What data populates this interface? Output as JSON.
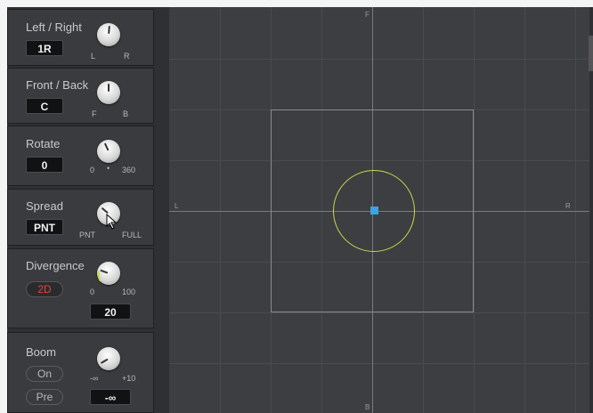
{
  "controls": {
    "left_right": {
      "title": "Left / Right",
      "value": "1R",
      "min": "L",
      "max": "R"
    },
    "front_back": {
      "title": "Front / Back",
      "value": "C",
      "min": "F",
      "max": "B"
    },
    "rotate": {
      "title": "Rotate",
      "value": "0",
      "min": "0",
      "mid": "•",
      "max": "360"
    },
    "spread": {
      "title": "Spread",
      "value": "PNT",
      "min": "PNT",
      "max": "FULL"
    },
    "divergence": {
      "title": "Divergence",
      "mode": "2D",
      "min": "0",
      "max": "100",
      "value": "20"
    },
    "boom": {
      "title": "Boom",
      "on_label": "On",
      "pre_label": "Pre",
      "min": "-∞",
      "max": "+10",
      "value": "-∞"
    }
  },
  "panner": {
    "top": "F",
    "bottom": "B",
    "left": "L",
    "right": "R"
  },
  "colors": {
    "accent_red": "#e0463c",
    "source_blue": "#3aa5e0",
    "spread_circle": "#c6d84a"
  }
}
